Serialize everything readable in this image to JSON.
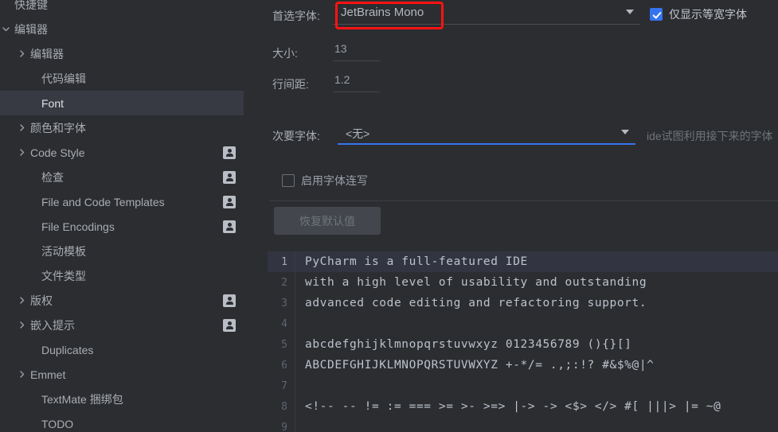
{
  "sidebar": {
    "items": [
      {
        "label": "快捷键",
        "indent": 18,
        "arrow": "none",
        "badge": false,
        "selected": false,
        "clipped": true
      },
      {
        "label": "编辑器",
        "indent": 18,
        "arrow": "down",
        "badge": false,
        "selected": false
      },
      {
        "label": "编辑器",
        "indent": 38,
        "arrow": "right",
        "badge": false,
        "selected": false
      },
      {
        "label": "代码编辑",
        "indent": 52,
        "arrow": "none",
        "badge": false,
        "selected": false
      },
      {
        "label": "Font",
        "indent": 52,
        "arrow": "none",
        "badge": false,
        "selected": true
      },
      {
        "label": "颜色和字体",
        "indent": 38,
        "arrow": "right",
        "badge": false,
        "selected": false
      },
      {
        "label": "Code Style",
        "indent": 38,
        "arrow": "right",
        "badge": true,
        "selected": false
      },
      {
        "label": "检查",
        "indent": 52,
        "arrow": "none",
        "badge": true,
        "selected": false
      },
      {
        "label": "File and Code Templates",
        "indent": 52,
        "arrow": "none",
        "badge": true,
        "selected": false
      },
      {
        "label": "File Encodings",
        "indent": 52,
        "arrow": "none",
        "badge": true,
        "selected": false
      },
      {
        "label": "活动模板",
        "indent": 52,
        "arrow": "none",
        "badge": false,
        "selected": false
      },
      {
        "label": "文件类型",
        "indent": 52,
        "arrow": "none",
        "badge": false,
        "selected": false
      },
      {
        "label": "版权",
        "indent": 38,
        "arrow": "right",
        "badge": true,
        "selected": false
      },
      {
        "label": "嵌入提示",
        "indent": 38,
        "arrow": "right",
        "badge": true,
        "selected": false
      },
      {
        "label": "Duplicates",
        "indent": 52,
        "arrow": "none",
        "badge": false,
        "selected": false
      },
      {
        "label": "Emmet",
        "indent": 38,
        "arrow": "right",
        "badge": false,
        "selected": false
      },
      {
        "label": "TextMate 捆绑包",
        "indent": 52,
        "arrow": "none",
        "badge": false,
        "selected": false
      },
      {
        "label": "TODO",
        "indent": 52,
        "arrow": "none",
        "badge": false,
        "selected": false
      }
    ]
  },
  "font_settings": {
    "primary_font_label": "首选字体:",
    "primary_font_value": "JetBrains Mono",
    "monospaced_only_label": "仅显示等宽字体",
    "monospaced_only_checked": true,
    "size_label": "大小:",
    "size_value": "13",
    "line_height_label": "行间距:",
    "line_height_value": "1.2",
    "secondary_font_label": "次要字体:",
    "secondary_font_value": "<无>",
    "secondary_hint": "ide试图利用接下来的字体",
    "ligatures_label": "启用字体连写",
    "ligatures_checked": false,
    "restore_defaults_label": "恢复默认值"
  },
  "preview": {
    "lines": [
      {
        "num": "1",
        "text": "PyCharm is a full-featured IDE",
        "current": true
      },
      {
        "num": "2",
        "text": "with a high level of usability and outstanding",
        "current": false
      },
      {
        "num": "3",
        "text": "advanced code editing and refactoring support.",
        "current": false
      },
      {
        "num": "4",
        "text": "",
        "current": false
      },
      {
        "num": "5",
        "text": "abcdefghijklmnopqrstuvwxyz 0123456789 (){}[]",
        "current": false
      },
      {
        "num": "6",
        "text": "ABCDEFGHIJKLMNOPQRSTUVWXYZ +-*/= .,;:!? #&$%@|^",
        "current": false
      },
      {
        "num": "7",
        "text": "",
        "current": false
      },
      {
        "num": "8",
        "text": "<!-- -- != := === >= >- >=> |-> -> <$> </> #[ |||> |= ~@",
        "current": false
      },
      {
        "num": "9",
        "text": "",
        "current": false
      }
    ]
  },
  "colors": {
    "accent_blue": "#3574f0",
    "annotation_red": "#fe1313",
    "panel_bg": "#2b2d30",
    "selected_row": "#373a43",
    "scrollbar_thumb": "#2f4061"
  }
}
